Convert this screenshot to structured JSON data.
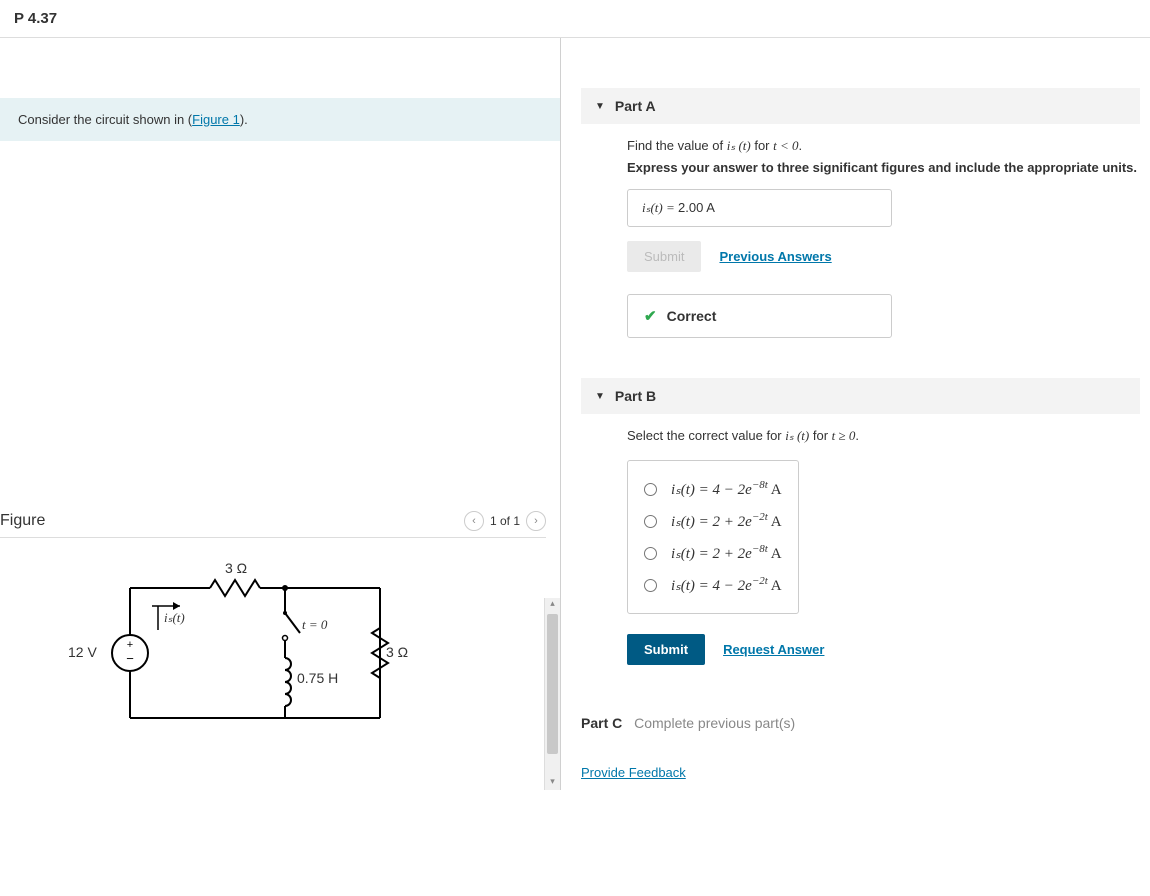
{
  "page_title": "P 4.37",
  "prompt_prefix": "Consider the circuit shown in (",
  "prompt_link": "Figure 1",
  "prompt_suffix": ").",
  "figure": {
    "title": "Figure",
    "pager": "1 of 1",
    "labels": {
      "voltage": "12 V",
      "r_top": "3 Ω",
      "r_right": "3 Ω",
      "inductor": "0.75 H",
      "switch": "t = 0",
      "current": "iₛ(t)"
    }
  },
  "partA": {
    "title": "Part A",
    "line1_pre": "Find the value of ",
    "line1_var": "iₛ (t)",
    "line1_post": " for ",
    "line1_cond": "t < 0",
    "line1_end": ".",
    "line2": "Express your answer to three significant figures and include the appropriate units.",
    "answer_lhs": "iₛ(t) = ",
    "answer_val": "2.00 A",
    "submit": "Submit",
    "prev": "Previous Answers",
    "feedback": "Correct"
  },
  "partB": {
    "title": "Part B",
    "prompt_pre": "Select the correct value for ",
    "prompt_var": "iₛ (t)",
    "prompt_mid": " for ",
    "prompt_cond": "t ≥ 0",
    "prompt_end": ".",
    "choices": [
      {
        "lhs": "iₛ(t) = 4 − 2e",
        "exp": "−8t",
        "unit": " A"
      },
      {
        "lhs": "iₛ(t) = 2 + 2e",
        "exp": "−2t",
        "unit": " A"
      },
      {
        "lhs": "iₛ(t) = 2 + 2e",
        "exp": "−8t",
        "unit": " A"
      },
      {
        "lhs": "iₛ(t) = 4 − 2e",
        "exp": "−2t",
        "unit": " A"
      }
    ],
    "submit": "Submit",
    "request": "Request Answer"
  },
  "partC": {
    "title": "Part C",
    "note": "Complete previous part(s)"
  },
  "feedback_link": "Provide Feedback"
}
